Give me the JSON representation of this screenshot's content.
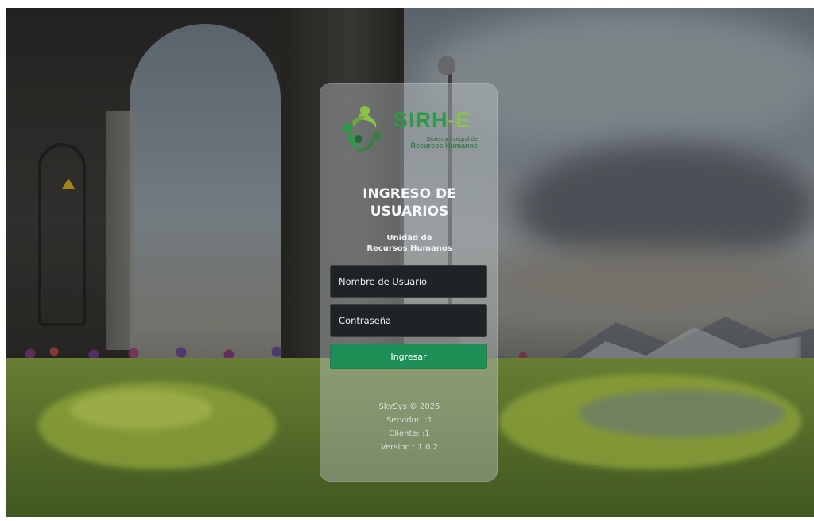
{
  "logo": {
    "title_main": "SIRH",
    "title_accent": "-E",
    "subtitle_line1": "Sistema Integral de",
    "subtitle_line2": "Recursos Humanos"
  },
  "login": {
    "heading_line1": "INGRESO DE",
    "heading_line2": "USUARIOS",
    "unit_line1": "Unidad de",
    "unit_line2": "Recursos Humanos",
    "username_placeholder": "Nombre de Usuario",
    "password_placeholder": "Contraseña",
    "submit_label": "Ingresar"
  },
  "footer": {
    "copyright": "SkySys © 2025",
    "server": "Servidor: :1",
    "client": "Cliente: :1",
    "version": "Version : 1.0.2"
  },
  "colors": {
    "brand_green": "#2f9a46",
    "brand_light_green": "#8bc34a",
    "button_green": "#1e8f57",
    "input_bg": "#1f2326"
  }
}
